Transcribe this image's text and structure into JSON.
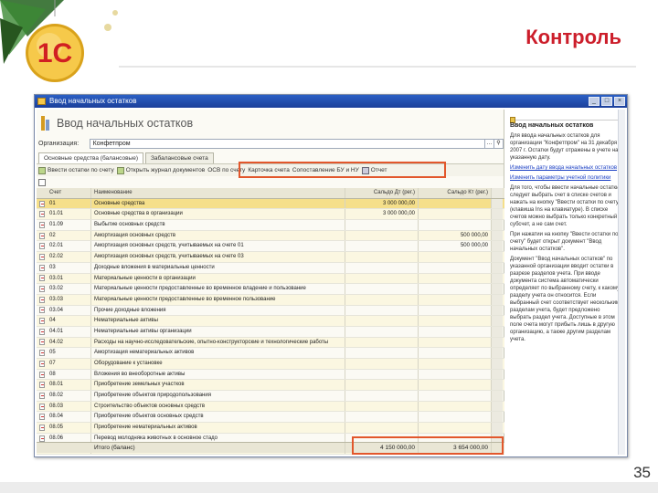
{
  "slide": {
    "title": "Контроль",
    "page_number": "35",
    "logo_text": "1С"
  },
  "window": {
    "title": "Ввод начальных остатков",
    "controls": [
      "_",
      "□",
      "×"
    ]
  },
  "doc": {
    "title": "Ввод начальных остатков",
    "org_label": "Организация:",
    "org_value": "Конфетпром"
  },
  "tabs": [
    {
      "label": "Основные средства (балансовые)"
    },
    {
      "label": "Забалансовые счета"
    }
  ],
  "toolbar": [
    {
      "label": "Ввести остатки по счету",
      "icon": "add-icon"
    },
    {
      "label": "Открыть журнал документов",
      "icon": "journal-icon"
    },
    {
      "label": "ОСВ по счету",
      "icon": "report-icon"
    },
    {
      "label": "Карточка счета",
      "icon": "card-icon"
    },
    {
      "label": "Сопоставление БУ и НУ",
      "icon": "compare-icon"
    },
    {
      "label": "Отчет",
      "icon": "print-icon"
    }
  ],
  "grid": {
    "headers": {
      "acc": "Счет",
      "name": "Наименование",
      "dt": "Сальдо Дт (рег.)",
      "kt": "Сальдо Кт (рег.)"
    },
    "rows": [
      {
        "acc": "01",
        "name": "Основные средства",
        "dt": "3 000 000,00",
        "kt": ""
      },
      {
        "acc": "01.01",
        "name": "Основные средства в организации",
        "dt": "3 000 000,00",
        "kt": ""
      },
      {
        "acc": "01.09",
        "name": "Выбытие основных средств",
        "dt": "",
        "kt": ""
      },
      {
        "acc": "02",
        "name": "Амортизация основных средств",
        "dt": "",
        "kt": "500 000,00"
      },
      {
        "acc": "02.01",
        "name": "Амортизация основных средств, учитываемых на счете 01",
        "dt": "",
        "kt": "500 000,00"
      },
      {
        "acc": "02.02",
        "name": "Амортизация основных средств, учитываемых на счете 03",
        "dt": "",
        "kt": ""
      },
      {
        "acc": "03",
        "name": "Доходные вложения в материальные ценности",
        "dt": "",
        "kt": ""
      },
      {
        "acc": "03.01",
        "name": "Материальные ценности в организации",
        "dt": "",
        "kt": ""
      },
      {
        "acc": "03.02",
        "name": "Материальные ценности предоставленные во временное владение и пользование",
        "dt": "",
        "kt": ""
      },
      {
        "acc": "03.03",
        "name": "Материальные ценности предоставленные во временное пользование",
        "dt": "",
        "kt": ""
      },
      {
        "acc": "03.04",
        "name": "Прочие доходные вложения",
        "dt": "",
        "kt": ""
      },
      {
        "acc": "04",
        "name": "Нематериальные активы",
        "dt": "",
        "kt": ""
      },
      {
        "acc": "04.01",
        "name": "Нематериальные активы организации",
        "dt": "",
        "kt": ""
      },
      {
        "acc": "04.02",
        "name": "Расходы на научно-исследовательские, опытно-конструкторские и технологические работы",
        "dt": "",
        "kt": ""
      },
      {
        "acc": "05",
        "name": "Амортизация нематериальных активов",
        "dt": "",
        "kt": ""
      },
      {
        "acc": "07",
        "name": "Оборудование к установке",
        "dt": "",
        "kt": ""
      },
      {
        "acc": "08",
        "name": "Вложения во внеоборотные активы",
        "dt": "",
        "kt": ""
      },
      {
        "acc": "08.01",
        "name": "Приобретение земельных участков",
        "dt": "",
        "kt": ""
      },
      {
        "acc": "08.02",
        "name": "Приобретение объектов природопользования",
        "dt": "",
        "kt": ""
      },
      {
        "acc": "08.03",
        "name": "Строительство объектов основных средств",
        "dt": "",
        "kt": ""
      },
      {
        "acc": "08.04",
        "name": "Приобретение объектов основных средств",
        "dt": "",
        "kt": ""
      },
      {
        "acc": "08.05",
        "name": "Приобретение нематериальных активов",
        "dt": "",
        "kt": ""
      },
      {
        "acc": "08.06",
        "name": "Перевод молодняка животных в основное стадо",
        "dt": "",
        "kt": ""
      },
      {
        "acc": "08.07",
        "name": "Приобретение взрослых животных",
        "dt": "",
        "kt": ""
      }
    ],
    "total": {
      "label": "Итого (баланс)",
      "dt": "4 150 000,00",
      "kt": "3 654 000,00"
    }
  },
  "help": {
    "title": "Ввод начальных остатков",
    "p1": "Для ввода начальных остатков для организации \"Конфетпром\" на 31 декабря 2007 г. Остатки будут отражены в учете на указанную дату.",
    "link1": "Изменить дату ввода начальных остатков",
    "link2": "Изменить параметры учетной политики",
    "p2": "Для того, чтобы ввести начальные остатки, следует выбрать счет в списке счетов и нажать на кнопку \"Ввести остатки по счету\" (клавиша Ins на клавиатуре). В списке счетов можно выбрать только конкретный субсчет, а не сам счет.",
    "p3": "При нажатии на кнопку \"Ввести остатки по счету\" будет открыт документ \"Ввод начальных остатков\".",
    "p4": "Документ \"Ввод начальных остатков\" по указанной организации вводит остатки в разрезе разделов учета. При вводе документа система автоматически определяет по выбранному счету, к какому разделу учета он относится. Если выбранный счет соответствует нескольким разделам учета, будет предложено выбрать раздел учета. Доступные в этом поле счета могут прибыть лишь в другую организацию, а также другим разделам учета."
  }
}
